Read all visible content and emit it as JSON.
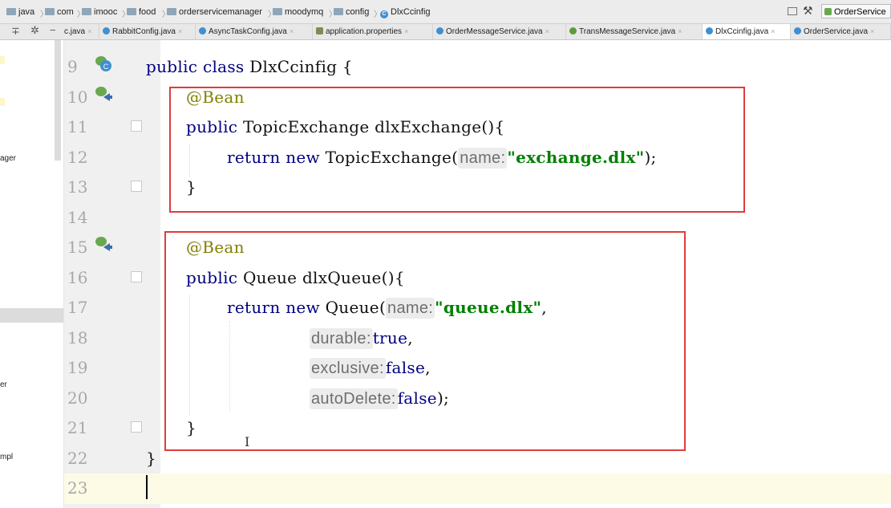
{
  "breadcrumb": [
    "java",
    "com",
    "imooc",
    "food",
    "orderservicemanager",
    "moodymq",
    "config",
    "DlxCcinfig"
  ],
  "run_config": "OrderService",
  "tabs": [
    {
      "label": "c.java",
      "icon": "class-icon",
      "active": false
    },
    {
      "label": "RabbitConfig.java",
      "icon": "class-icon",
      "active": false
    },
    {
      "label": "AsyncTaskConfig.java",
      "icon": "class-icon",
      "active": false
    },
    {
      "label": "application.properties",
      "icon": "properties-icon",
      "active": false
    },
    {
      "label": "OrderMessageService.java",
      "icon": "class-icon",
      "active": false
    },
    {
      "label": "TransMessageService.java",
      "icon": "interface-icon",
      "active": false
    },
    {
      "label": "DlxCcinfig.java",
      "icon": "class-icon",
      "active": true
    },
    {
      "label": "OrderService.java",
      "icon": "class-icon",
      "active": false
    }
  ],
  "sidebar_fragments": [
    "ager",
    "er",
    "mpl"
  ],
  "line_numbers": [
    "9",
    "10",
    "11",
    "12",
    "13",
    "14",
    "15",
    "16",
    "17",
    "18",
    "19",
    "20",
    "21",
    "22",
    "23"
  ],
  "code": {
    "class_decl": {
      "kw": "public class ",
      "name": "DlxCcinfig {"
    },
    "bean1_annotation": "@Bean",
    "exchange_method": {
      "kw": "public ",
      "rest": "TopicExchange dlxExchange(){"
    },
    "exchange_return": {
      "kw": "return new ",
      "type": "TopicExchange(",
      "hint": "name:",
      "str": "\"exchange.dlx\"",
      "end": ");"
    },
    "close_brace": "}",
    "bean2_annotation": "@Bean",
    "queue_method": {
      "kw": "public ",
      "rest": "Queue dlxQueue(){"
    },
    "queue_return": {
      "kw": "return new ",
      "type": "Queue(",
      "hint": "name:",
      "str": "\"queue.dlx\"",
      "end": ","
    },
    "durable": {
      "hint": "durable:",
      "value": "true",
      "end": ","
    },
    "exclusive": {
      "hint": "exclusive:",
      "value": "false",
      "end": ","
    },
    "autodelete": {
      "hint": "autoDelete:",
      "value": "false",
      "end": ");"
    }
  },
  "colors": {
    "annotation_box": "#e03c3c",
    "keyword": "#000080",
    "string": "#008000",
    "annotation": "#808000"
  }
}
